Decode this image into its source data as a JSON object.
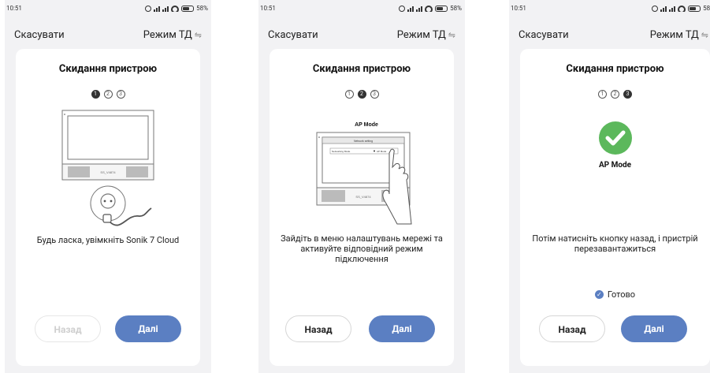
{
  "status": {
    "time": "10:51",
    "battery": "58%"
  },
  "header": {
    "cancel_label": "Скасувати",
    "mode_label": "Режим ТД",
    "mode_icon": "swap-arrows-icon"
  },
  "screens": [
    {
      "title": "Скидання пристрою",
      "active_step": 1,
      "steps": [
        "1",
        "2",
        "3"
      ],
      "monitor_model": "SS_V4874",
      "caption": "Будь ласка, увімкніть Sonik 7 Cloud",
      "back_label": "Назад",
      "back_enabled": false,
      "next_label": "Далі"
    },
    {
      "title": "Скидання пристрою",
      "active_step": 2,
      "steps": [
        "1",
        "2",
        "3"
      ],
      "illus_title": "AP Mode",
      "screen_header": "Network setting",
      "screen_row_left": "Networking Mode",
      "screen_row_right": "AP Mode",
      "monitor_model": "SS_V4874",
      "caption": "Зайдіть в меню налаштувань мережі та активуйте відповідний режим підключення",
      "back_label": "Назад",
      "back_enabled": true,
      "next_label": "Далі"
    },
    {
      "title": "Скидання пристрою",
      "active_step": 3,
      "steps": [
        "1",
        "2",
        "3"
      ],
      "illus_title": "AP Mode",
      "caption": "Потім натисніть кнопку назад, і пристрій перезавантажиться",
      "checkbox_label": "Готово",
      "checkbox_checked": true,
      "back_label": "Назад",
      "back_enabled": true,
      "next_label": "Далі"
    }
  ],
  "colors": {
    "primary": "#5b7fc2",
    "success": "#5cb85c",
    "background": "#f2f2f4"
  }
}
